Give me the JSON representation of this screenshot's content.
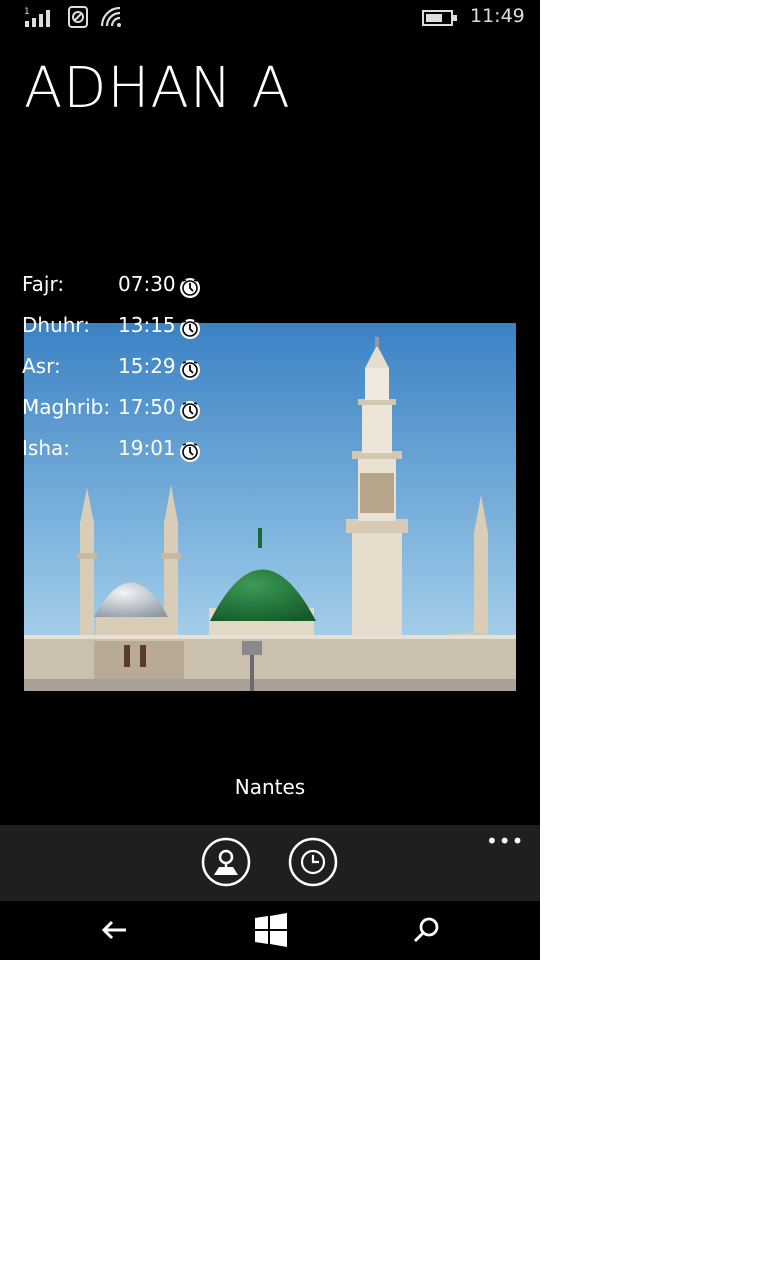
{
  "status_bar": {
    "time": "11:49",
    "icons": [
      "signal-icon",
      "sim-icon",
      "wifi-icon",
      "battery-icon"
    ]
  },
  "app": {
    "title": "ADHAN A"
  },
  "prayers": [
    {
      "name": "Fajr:",
      "time": "07:30"
    },
    {
      "name": "Dhuhr:",
      "time": "13:15"
    },
    {
      "name": "Asr:",
      "time": "15:29"
    },
    {
      "name": "Maghrib:",
      "time": "17:50"
    },
    {
      "name": "Isha:",
      "time": "19:01"
    }
  ],
  "location": {
    "city": "Nantes"
  },
  "app_bar": {
    "buttons": [
      "location-map-icon",
      "clock-icon"
    ],
    "more_label": "•••"
  },
  "nav_bar": {
    "buttons": [
      "back-icon",
      "windows-start-icon",
      "search-icon"
    ]
  },
  "colors": {
    "background": "#000000",
    "app_bar": "#1f1f1f",
    "text": "#ffffff"
  }
}
